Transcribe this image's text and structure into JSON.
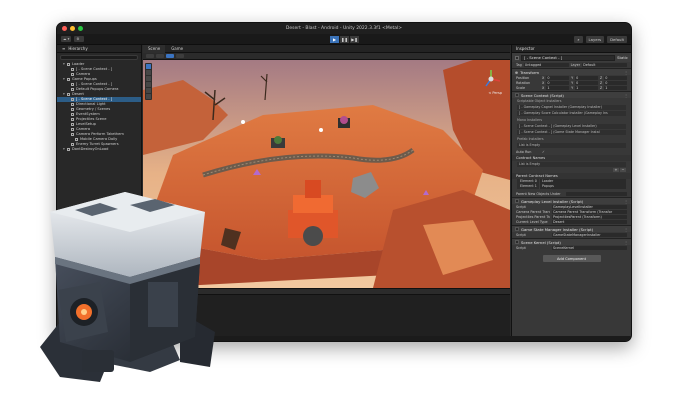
{
  "window": {
    "title": "Desert - Blast - Android - Unity 2022.3.3f1 <Metal>",
    "traffic_colors": [
      "#ff5f57",
      "#febc2e",
      "#28c840"
    ]
  },
  "toolbar": {
    "left_chips": [
      "",
      "",
      ""
    ],
    "play_controls": [
      "▶",
      "❚❚",
      "▶❚"
    ],
    "layers_label": "Layers",
    "layout_label": "Default"
  },
  "hierarchy": {
    "tab": "Hierarchy",
    "items": [
      {
        "label": "Loader",
        "indent": 1,
        "selected": false
      },
      {
        "label": "[ - Scene Context - ]",
        "indent": 2,
        "selected": false
      },
      {
        "label": "Camera",
        "indent": 2,
        "selected": false
      },
      {
        "label": "Game Popups",
        "indent": 1,
        "selected": false
      },
      {
        "label": "[ - Scene Context - ]",
        "indent": 2,
        "selected": false
      },
      {
        "label": "Default Popups Camera",
        "indent": 2,
        "selected": false
      },
      {
        "label": "Desert",
        "indent": 1,
        "selected": false
      },
      {
        "label": "[ - Scene Context - ]",
        "indent": 2,
        "selected": true
      },
      {
        "label": "Directional Light",
        "indent": 2,
        "selected": false
      },
      {
        "label": "Geometry / Scenes",
        "indent": 2,
        "selected": false
      },
      {
        "label": "EventSystem",
        "indent": 2,
        "selected": false
      },
      {
        "label": "Projectiles Scene",
        "indent": 2,
        "selected": false
      },
      {
        "label": "LevelSetup",
        "indent": 2,
        "selected": false
      },
      {
        "label": "Camera",
        "indent": 2,
        "selected": false
      },
      {
        "label": "Camera Perform Takethem",
        "indent": 2,
        "selected": false
      },
      {
        "label": "Mobile Camera Dolly",
        "indent": 3,
        "selected": false
      },
      {
        "label": "Enemy Turret Spawners",
        "indent": 2,
        "selected": false
      },
      {
        "label": "DontDestroyOnLoad",
        "indent": 1,
        "selected": false
      }
    ]
  },
  "scene": {
    "tabs": [
      "Scene",
      "Game"
    ],
    "persp_label": "< Persp"
  },
  "inspector": {
    "tab": "Inspector",
    "object_name": "[ - Scene Context - ]",
    "static_label": "Static",
    "tag_label": "Tag",
    "tag_value": "Untagged",
    "layer_label": "Layer",
    "layer_value": "Default",
    "transform": {
      "title": "Transform",
      "rows": [
        {
          "label": "Position",
          "x": "0",
          "y": "0",
          "z": "0"
        },
        {
          "label": "Rotation",
          "x": "0",
          "y": "0",
          "z": "0"
        },
        {
          "label": "Scale",
          "x": "1",
          "y": "1",
          "z": "1"
        }
      ]
    },
    "scene_context": {
      "title": "Scene Context (Script)",
      "scriptable_label": "Scriptable Object Installers",
      "installers": [
        "[ - Gameplay Cagnel Installer (Gameplay Installer)",
        "[ - Gameplay Score Calculator Installer (Gameplay Ins"
      ],
      "mono_label": "Mono Installers",
      "mono_items": [
        "[ - Scene Context - ] (Gameplay Level Installer)",
        "[ - Scene Context - ] (Game State Manager Instal"
      ],
      "prefab_label": "Prefab Installers",
      "list_empty": "List is Empty",
      "auto_run_label": "Auto Run",
      "contract_names_label": "Contract Names",
      "parent_contract_label": "Parent Contract Names",
      "elements": [
        {
          "key": "Element 0",
          "value": "Loader"
        },
        {
          "key": "Element 1",
          "value": "Popups"
        }
      ],
      "parent_new_label": "Parent New Objects Under"
    },
    "components": [
      {
        "title": "Gameplay Level Installer (Script)",
        "rows": [
          {
            "k": "Script",
            "v": "GameplayLevelInstaller"
          },
          {
            "k": "Camera Parent Transform",
            "v": "Camera Parent Transform (Transfor"
          },
          {
            "k": "Projectiles Parent Transf",
            "v": "ProjectilesParent (Transform)"
          },
          {
            "k": "Current Level Type",
            "v": "Desert"
          }
        ]
      },
      {
        "title": "Game State Manager Installer (Script)",
        "rows": [
          {
            "k": "Script",
            "v": "GameStateManagerInstaller"
          }
        ]
      },
      {
        "title": "Scene Kernel (Script)",
        "rows": [
          {
            "k": "Script",
            "v": "SceneKernel"
          }
        ]
      }
    ],
    "add_component": "Add Component"
  },
  "colors": {
    "accent": "#3b74c2",
    "selection": "#2c5d87",
    "sand": "#d9693a",
    "sky": "#e7b287"
  }
}
